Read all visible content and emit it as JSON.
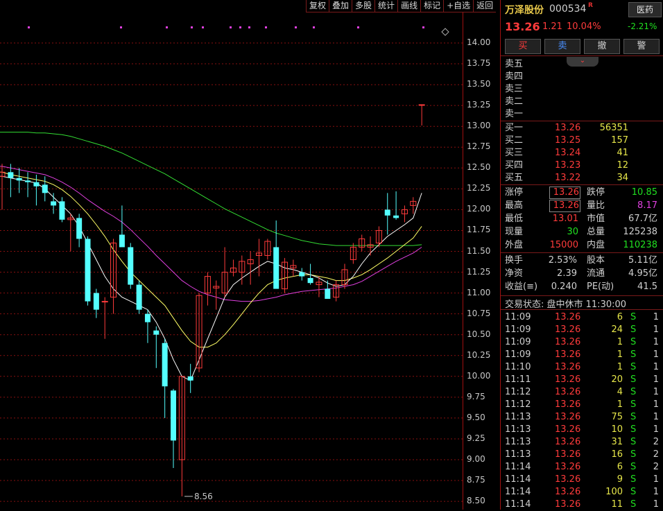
{
  "toolbar": [
    "复权",
    "叠加",
    "多股",
    "统计",
    "画线",
    "标记",
    "+自选",
    "返回"
  ],
  "stock": {
    "name": "万泽股份",
    "code": "000534",
    "badge": "R",
    "price": "13.26",
    "change": "1.21",
    "pct": "10.04%",
    "sector": "医药",
    "sector_chg": "-2.21%"
  },
  "trade_buttons": [
    "买",
    "卖",
    "撤",
    "警"
  ],
  "orderbook": {
    "sell": [
      "卖五",
      "卖四",
      "卖三",
      "卖二",
      "卖一"
    ],
    "buy": [
      {
        "label": "买一",
        "price": "13.26",
        "vol": "56351"
      },
      {
        "label": "买二",
        "price": "13.25",
        "vol": "157"
      },
      {
        "label": "买三",
        "price": "13.24",
        "vol": "41"
      },
      {
        "label": "买四",
        "price": "13.23",
        "vol": "12"
      },
      {
        "label": "买五",
        "price": "13.22",
        "vol": "34"
      }
    ]
  },
  "quote": {
    "left": [
      {
        "label": "涨停",
        "value": "13.26",
        "color": "red",
        "boxed": true
      },
      {
        "label": "最高",
        "value": "13.26",
        "color": "red",
        "boxed": true
      },
      {
        "label": "最低",
        "value": "13.01",
        "color": "red"
      },
      {
        "label": "现量",
        "value": "30",
        "color": "green"
      },
      {
        "label": "外盘",
        "value": "15000",
        "color": "red"
      }
    ],
    "right": [
      {
        "label": "跌停",
        "value": "10.85",
        "color": "green"
      },
      {
        "label": "量比",
        "value": "8.17",
        "color": "purple"
      },
      {
        "label": "市值",
        "value": "67.7亿",
        "color": "white"
      },
      {
        "label": "总量",
        "value": "125238",
        "color": "white"
      },
      {
        "label": "内盘",
        "value": "110238",
        "color": "green"
      }
    ]
  },
  "fundamentals": {
    "left": [
      {
        "label": "换手",
        "value": "2.53%"
      },
      {
        "label": "净资",
        "value": "2.39"
      },
      {
        "label": "收益(≡)",
        "value": "0.240"
      }
    ],
    "right": [
      {
        "label": "股本",
        "value": "5.11亿"
      },
      {
        "label": "流通",
        "value": "4.95亿"
      },
      {
        "label": "PE(动)",
        "value": "41.5"
      }
    ]
  },
  "status": "交易状态: 盘中休市 11:30:00",
  "ticks": [
    {
      "time": "11:09",
      "price": "13.26",
      "vol": "6",
      "side": "S",
      "n": "1"
    },
    {
      "time": "11:09",
      "price": "13.26",
      "vol": "24",
      "side": "S",
      "n": "1"
    },
    {
      "time": "11:09",
      "price": "13.26",
      "vol": "1",
      "side": "S",
      "n": "1"
    },
    {
      "time": "11:09",
      "price": "13.26",
      "vol": "1",
      "side": "S",
      "n": "1"
    },
    {
      "time": "11:10",
      "price": "13.26",
      "vol": "1",
      "side": "S",
      "n": "1"
    },
    {
      "time": "11:11",
      "price": "13.26",
      "vol": "20",
      "side": "S",
      "n": "1"
    },
    {
      "time": "11:12",
      "price": "13.26",
      "vol": "4",
      "side": "S",
      "n": "1"
    },
    {
      "time": "11:12",
      "price": "13.26",
      "vol": "1",
      "side": "S",
      "n": "1"
    },
    {
      "time": "11:13",
      "price": "13.26",
      "vol": "75",
      "side": "S",
      "n": "1"
    },
    {
      "time": "11:13",
      "price": "13.26",
      "vol": "10",
      "side": "S",
      "n": "1"
    },
    {
      "time": "11:13",
      "price": "13.26",
      "vol": "31",
      "side": "S",
      "n": "2"
    },
    {
      "time": "11:13",
      "price": "13.26",
      "vol": "16",
      "side": "S",
      "n": "2"
    },
    {
      "time": "11:14",
      "price": "13.26",
      "vol": "6",
      "side": "S",
      "n": "2"
    },
    {
      "time": "11:14",
      "price": "13.26",
      "vol": "9",
      "side": "S",
      "n": "1"
    },
    {
      "time": "11:14",
      "price": "13.26",
      "vol": "100",
      "side": "S",
      "n": "1"
    },
    {
      "time": "11:14",
      "price": "13.26",
      "vol": "11",
      "side": "S",
      "n": "1"
    }
  ],
  "colors": {
    "up": "#ff3b3b",
    "down": "#54ffff",
    "ma5": "#ffffff",
    "ma10": "#ffff66",
    "ma20": "#e040e0",
    "ma60": "#33dd33",
    "grid": "#8a1010"
  },
  "chart_data": {
    "type": "candlestick",
    "y_ticks": [
      "14.00",
      "13.75",
      "13.50",
      "13.25",
      "13.00",
      "12.75",
      "12.50",
      "12.25",
      "12.00",
      "11.75",
      "11.50",
      "11.25",
      "11.00",
      "10.75",
      "10.50",
      "10.25",
      "10.00",
      "9.75",
      "9.50",
      "9.25",
      "9.00",
      "8.75",
      "8.50"
    ],
    "ylim": [
      8.45,
      14.45
    ],
    "low_annotation": "8.56",
    "candles": [
      {
        "o": 12.4,
        "h": 12.55,
        "l": 12.0,
        "c": 12.45
      },
      {
        "o": 12.45,
        "h": 12.55,
        "l": 12.15,
        "c": 12.38
      },
      {
        "o": 12.38,
        "h": 12.5,
        "l": 12.2,
        "c": 12.35
      },
      {
        "o": 12.35,
        "h": 12.45,
        "l": 12.15,
        "c": 12.33
      },
      {
        "o": 12.33,
        "h": 12.42,
        "l": 12.05,
        "c": 12.28
      },
      {
        "o": 12.3,
        "h": 12.4,
        "l": 12.1,
        "c": 12.2
      },
      {
        "o": 12.1,
        "h": 12.2,
        "l": 11.95,
        "c": 12.05
      },
      {
        "o": 12.1,
        "h": 12.15,
        "l": 11.85,
        "c": 11.88
      },
      {
        "o": 11.88,
        "h": 11.95,
        "l": 11.5,
        "c": 11.9
      },
      {
        "o": 11.9,
        "h": 11.95,
        "l": 11.55,
        "c": 11.65
      },
      {
        "o": 11.65,
        "h": 11.68,
        "l": 10.85,
        "c": 10.9
      },
      {
        "o": 11.0,
        "h": 11.05,
        "l": 10.7,
        "c": 10.8
      },
      {
        "o": 10.9,
        "h": 10.95,
        "l": 10.45,
        "c": 10.9
      },
      {
        "o": 10.95,
        "h": 11.65,
        "l": 10.75,
        "c": 11.6
      },
      {
        "o": 11.7,
        "h": 12.05,
        "l": 11.6,
        "c": 11.55
      },
      {
        "o": 11.55,
        "h": 11.6,
        "l": 11.05,
        "c": 11.1
      },
      {
        "o": 11.1,
        "h": 11.15,
        "l": 10.75,
        "c": 10.8
      },
      {
        "o": 10.75,
        "h": 10.8,
        "l": 10.4,
        "c": 10.65
      },
      {
        "o": 10.55,
        "h": 10.6,
        "l": 10.1,
        "c": 10.5
      },
      {
        "o": 10.4,
        "h": 10.45,
        "l": 9.5,
        "c": 9.88
      },
      {
        "o": 9.83,
        "h": 9.85,
        "l": 8.9,
        "c": 9.23
      },
      {
        "o": 9.0,
        "h": 10.0,
        "l": 8.56,
        "c": 10.0
      },
      {
        "o": 10.0,
        "h": 10.15,
        "l": 9.8,
        "c": 9.95
      },
      {
        "o": 10.1,
        "h": 11.0,
        "l": 10.05,
        "c": 10.97
      },
      {
        "o": 11.0,
        "h": 11.25,
        "l": 10.85,
        "c": 11.2
      },
      {
        "o": 11.06,
        "h": 11.15,
        "l": 10.8,
        "c": 11.08
      },
      {
        "o": 11.0,
        "h": 11.55,
        "l": 10.95,
        "c": 11.25
      },
      {
        "o": 11.25,
        "h": 11.4,
        "l": 11.2,
        "c": 11.3
      },
      {
        "o": 11.25,
        "h": 11.45,
        "l": 11.1,
        "c": 11.38
      },
      {
        "o": 11.35,
        "h": 11.5,
        "l": 11.1,
        "c": 11.4
      },
      {
        "o": 11.45,
        "h": 11.65,
        "l": 11.2,
        "c": 11.48
      },
      {
        "o": 11.45,
        "h": 11.65,
        "l": 11.4,
        "c": 11.62
      },
      {
        "o": 11.55,
        "h": 11.87,
        "l": 11.1,
        "c": 11.05
      },
      {
        "o": 11.05,
        "h": 11.42,
        "l": 11.0,
        "c": 11.37
      },
      {
        "o": 11.3,
        "h": 11.4,
        "l": 11.2,
        "c": 11.33
      },
      {
        "o": 11.25,
        "h": 11.3,
        "l": 11.15,
        "c": 11.2
      },
      {
        "o": 11.18,
        "h": 11.35,
        "l": 11.1,
        "c": 11.12
      },
      {
        "o": 11.1,
        "h": 11.2,
        "l": 10.95,
        "c": 11.13
      },
      {
        "o": 11.05,
        "h": 11.15,
        "l": 10.95,
        "c": 10.93
      },
      {
        "o": 10.95,
        "h": 11.15,
        "l": 10.9,
        "c": 11.1
      },
      {
        "o": 11.1,
        "h": 11.35,
        "l": 11.05,
        "c": 11.28
      },
      {
        "o": 11.4,
        "h": 11.6,
        "l": 11.35,
        "c": 11.55
      },
      {
        "o": 11.55,
        "h": 11.7,
        "l": 11.5,
        "c": 11.65
      },
      {
        "o": 11.55,
        "h": 11.68,
        "l": 11.45,
        "c": 11.58
      },
      {
        "o": 11.6,
        "h": 11.8,
        "l": 11.55,
        "c": 11.75
      },
      {
        "o": 12.0,
        "h": 12.2,
        "l": 11.7,
        "c": 11.93
      },
      {
        "o": 11.93,
        "h": 12.22,
        "l": 11.88,
        "c": 11.9
      },
      {
        "o": 11.95,
        "h": 12.05,
        "l": 11.85,
        "c": 12.0
      },
      {
        "o": 12.05,
        "h": 12.15,
        "l": 11.95,
        "c": 12.1
      },
      {
        "o": 13.26,
        "h": 13.26,
        "l": 13.01,
        "c": 13.26
      }
    ],
    "ma5": [
      12.4,
      12.38,
      12.36,
      12.34,
      12.32,
      12.25,
      12.15,
      12.05,
      11.95,
      11.8,
      11.6,
      11.4,
      11.2,
      11.05,
      10.95,
      10.9,
      10.85,
      10.8,
      10.65,
      10.45,
      10.2,
      10.0,
      9.95,
      10.2,
      10.45,
      10.7,
      10.95,
      11.1,
      11.18,
      11.25,
      11.32,
      11.38,
      11.35,
      11.3,
      11.28,
      11.25,
      11.22,
      11.18,
      11.12,
      11.08,
      11.1,
      11.2,
      11.35,
      11.48,
      11.58,
      11.68,
      11.75,
      11.82,
      11.9,
      12.2
    ],
    "ma10": [
      12.45,
      12.42,
      12.4,
      12.38,
      12.36,
      12.34,
      12.3,
      12.24,
      12.16,
      12.06,
      11.95,
      11.82,
      11.68,
      11.52,
      11.38,
      11.25,
      11.15,
      11.05,
      10.95,
      10.85,
      10.7,
      10.55,
      10.42,
      10.35,
      10.35,
      10.4,
      10.5,
      10.62,
      10.75,
      10.88,
      11.0,
      11.1,
      11.15,
      11.18,
      11.2,
      11.22,
      11.22,
      11.2,
      11.18,
      11.15,
      11.15,
      11.18,
      11.22,
      11.28,
      11.35,
      11.42,
      11.5,
      11.58,
      11.66,
      11.8
    ],
    "ma20": [
      12.52,
      12.5,
      12.48,
      12.46,
      12.44,
      12.42,
      12.38,
      12.33,
      12.27,
      12.2,
      12.12,
      12.05,
      11.98,
      11.92,
      11.85,
      11.76,
      11.66,
      11.56,
      11.45,
      11.35,
      11.25,
      11.15,
      11.08,
      11.02,
      10.98,
      10.95,
      10.92,
      10.91,
      10.9,
      10.9,
      10.91,
      10.93,
      10.95,
      10.98,
      11.0,
      11.02,
      11.03,
      11.04,
      11.05,
      11.06,
      11.08,
      11.1,
      11.14,
      11.2,
      11.26,
      11.32,
      11.38,
      11.43,
      11.48,
      11.55
    ],
    "ma60": [
      12.93,
      12.93,
      12.93,
      12.93,
      12.92,
      12.92,
      12.91,
      12.9,
      12.88,
      12.85,
      12.82,
      12.79,
      12.76,
      12.72,
      12.68,
      12.63,
      12.58,
      12.53,
      12.48,
      12.43,
      12.37,
      12.31,
      12.25,
      12.19,
      12.13,
      12.07,
      12.01,
      11.96,
      11.91,
      11.86,
      11.81,
      11.76,
      11.72,
      11.69,
      11.66,
      11.63,
      11.61,
      11.59,
      11.58,
      11.57,
      11.57,
      11.57,
      11.57,
      11.57,
      11.57,
      11.57,
      11.57,
      11.57,
      11.57,
      11.58
    ]
  }
}
